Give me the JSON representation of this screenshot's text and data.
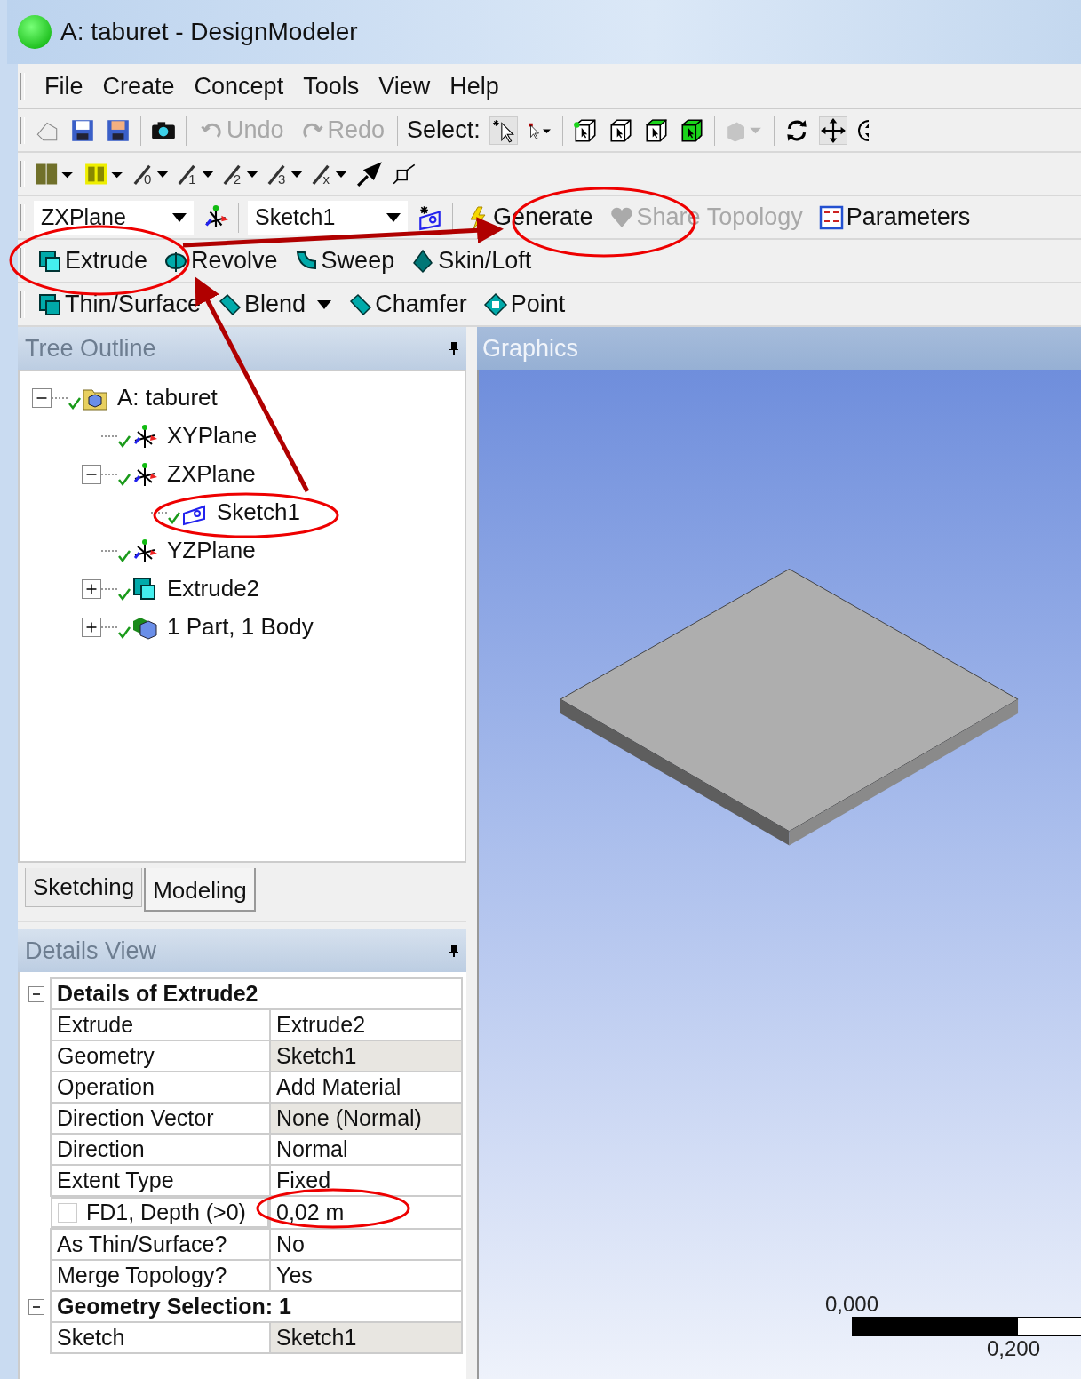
{
  "window": {
    "title": "A: taburet - DesignModeler"
  },
  "menu": [
    "File",
    "Create",
    "Concept",
    "Tools",
    "View",
    "Help"
  ],
  "edit_tools": [
    {
      "label": "Undo",
      "kind": "undo",
      "disabled": true
    },
    {
      "label": "Redo",
      "kind": "redo",
      "disabled": true
    }
  ],
  "select_label": "Select:",
  "line_tools": [
    "0",
    "1",
    "2",
    "3",
    "x"
  ],
  "plane_combo": "ZXPlane",
  "sketch_combo": "Sketch1",
  "feature_rows": [
    [
      {
        "label": "Generate",
        "kind": "generate",
        "disabled": false,
        "dropdown": false
      },
      {
        "label": "Share Topology",
        "kind": "share",
        "disabled": true,
        "dropdown": false
      },
      {
        "label": "Parameters",
        "kind": "parameters",
        "disabled": false,
        "dropdown": false
      }
    ],
    [
      {
        "label": "Extrude",
        "kind": "extrude",
        "disabled": false,
        "dropdown": false
      },
      {
        "label": "Revolve",
        "kind": "revolve",
        "disabled": false,
        "dropdown": false
      },
      {
        "label": "Sweep",
        "kind": "sweep",
        "disabled": false,
        "dropdown": false
      },
      {
        "label": "Skin/Loft",
        "kind": "skin",
        "disabled": false,
        "dropdown": false
      }
    ],
    [
      {
        "label": "Thin/Surface",
        "kind": "thin",
        "disabled": false,
        "dropdown": false
      },
      {
        "label": "Blend",
        "kind": "blend",
        "disabled": false,
        "dropdown": true
      },
      {
        "label": "Chamfer",
        "kind": "chamfer",
        "disabled": false,
        "dropdown": false
      },
      {
        "label": "Point",
        "kind": "point",
        "disabled": false,
        "dropdown": false
      }
    ]
  ],
  "tree_outline": {
    "title": "Tree Outline",
    "nodes": [
      {
        "label": "A: taburet",
        "kind": "model",
        "expanded": true,
        "children": [
          {
            "label": "XYPlane",
            "kind": "plane"
          },
          {
            "label": "ZXPlane",
            "kind": "plane",
            "expanded": true,
            "children": [
              {
                "label": "Sketch1",
                "kind": "sketch"
              }
            ]
          },
          {
            "label": "YZPlane",
            "kind": "plane"
          },
          {
            "label": "Extrude2",
            "kind": "extrude",
            "expanded": false
          },
          {
            "label": "1 Part, 1 Body",
            "kind": "body",
            "expanded": false
          }
        ]
      }
    ]
  },
  "tabs": [
    {
      "label": "Sketching",
      "selected": false
    },
    {
      "label": "Modeling",
      "selected": true
    }
  ],
  "details_view": {
    "title": "Details View",
    "sections": [
      {
        "title": "Details of Extrude2",
        "expanded": true,
        "rows": [
          {
            "kind": "property",
            "label": "Extrude",
            "value": "Extrude2",
            "shaded": false
          },
          {
            "kind": "property",
            "label": "Geometry",
            "value": "Sketch1",
            "shaded": true
          },
          {
            "kind": "property",
            "label": "Operation",
            "value": "Add Material",
            "shaded": false
          },
          {
            "kind": "property",
            "label": "Direction Vector",
            "value": "None (Normal)",
            "shaded": true
          },
          {
            "kind": "property",
            "label": "Direction",
            "value": "Normal",
            "shaded": false
          },
          {
            "kind": "property",
            "label": "Extent Type",
            "value": "Fixed",
            "shaded": false
          },
          {
            "kind": "parameter",
            "label": "FD1,  Depth (>0)",
            "value": "0,02 m",
            "shaded": false,
            "checked": false
          },
          {
            "kind": "property",
            "label": "As Thin/Surface?",
            "value": "No",
            "shaded": false
          },
          {
            "kind": "property",
            "label": "Merge Topology?",
            "value": "Yes",
            "shaded": false
          }
        ]
      },
      {
        "title": "Geometry Selection: 1",
        "expanded": true,
        "rows": [
          {
            "kind": "property",
            "label": "Sketch",
            "value": "Sketch1",
            "shaded": true
          }
        ]
      }
    ]
  },
  "graphics": {
    "title": "Graphics",
    "scale_start": "0,000",
    "scale_end": "0,200"
  }
}
